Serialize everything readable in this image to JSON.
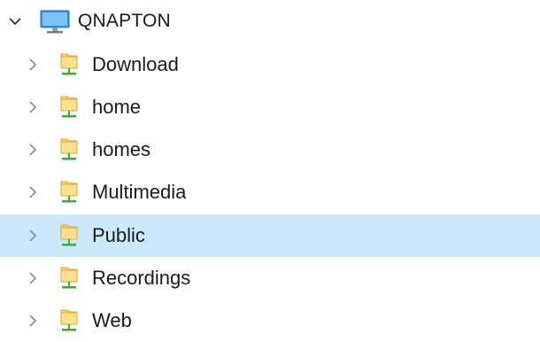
{
  "tree": {
    "root": {
      "label": "QNAPTON",
      "icon": "computer-icon",
      "expanded": true
    },
    "items": [
      {
        "label": "Download",
        "icon": "network-share-icon",
        "selected": false
      },
      {
        "label": "home",
        "icon": "network-share-icon",
        "selected": false
      },
      {
        "label": "homes",
        "icon": "network-share-icon",
        "selected": false
      },
      {
        "label": "Multimedia",
        "icon": "network-share-icon",
        "selected": false
      },
      {
        "label": "Public",
        "icon": "network-share-icon",
        "selected": true
      },
      {
        "label": "Recordings",
        "icon": "network-share-icon",
        "selected": false
      },
      {
        "label": "Web",
        "icon": "network-share-icon",
        "selected": false
      }
    ],
    "colors": {
      "selection": "#cce8ff",
      "folder": "#f7d26b",
      "folder_outline": "#d9a93a",
      "network_green": "#3ea83a",
      "monitor_blue": "#3a8fd8"
    }
  }
}
